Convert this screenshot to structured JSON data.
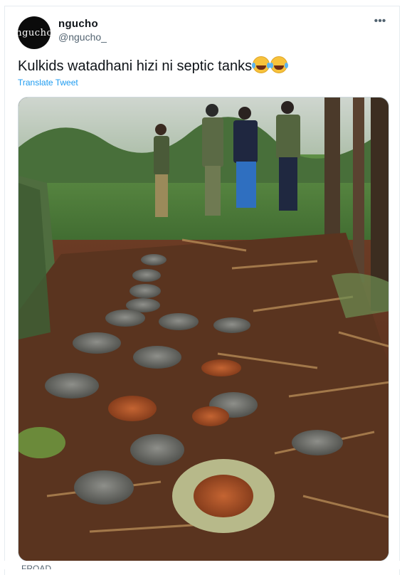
{
  "author": {
    "display_name": "ngucho",
    "handle": "@ngucho_",
    "avatar_text": "ngucho"
  },
  "tweet": {
    "text": "Kulkids watadhani hizi ni septic tanks",
    "emoji": [
      "face-with-tears-of-joy",
      "face-with-tears-of-joy"
    ],
    "translate_label": "Translate Tweet"
  },
  "more_icon": "more-horizontal-icon",
  "media": {
    "icon": "photo",
    "description_visible": false
  },
  "footer": {
    "partial_text": "FROAD"
  },
  "colors": {
    "link": "#1d9bf0",
    "secondary_text": "#536471",
    "border": "#e6ecf0"
  }
}
